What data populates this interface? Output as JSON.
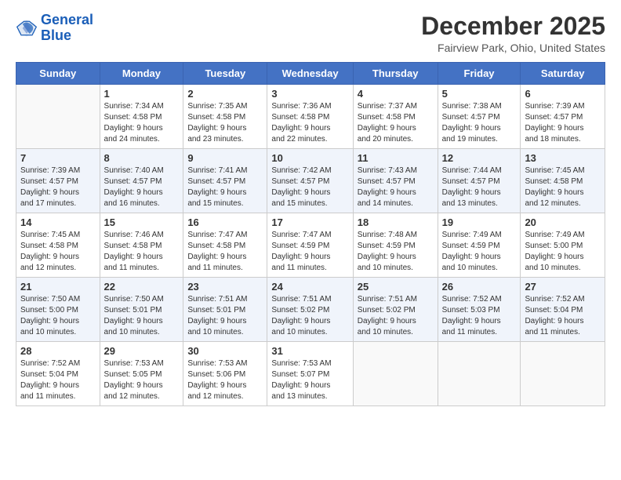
{
  "logo": {
    "line1": "General",
    "line2": "Blue"
  },
  "title": "December 2025",
  "subtitle": "Fairview Park, Ohio, United States",
  "days_header": [
    "Sunday",
    "Monday",
    "Tuesday",
    "Wednesday",
    "Thursday",
    "Friday",
    "Saturday"
  ],
  "weeks": [
    [
      {
        "num": "",
        "info": ""
      },
      {
        "num": "1",
        "info": "Sunrise: 7:34 AM\nSunset: 4:58 PM\nDaylight: 9 hours\nand 24 minutes."
      },
      {
        "num": "2",
        "info": "Sunrise: 7:35 AM\nSunset: 4:58 PM\nDaylight: 9 hours\nand 23 minutes."
      },
      {
        "num": "3",
        "info": "Sunrise: 7:36 AM\nSunset: 4:58 PM\nDaylight: 9 hours\nand 22 minutes."
      },
      {
        "num": "4",
        "info": "Sunrise: 7:37 AM\nSunset: 4:58 PM\nDaylight: 9 hours\nand 20 minutes."
      },
      {
        "num": "5",
        "info": "Sunrise: 7:38 AM\nSunset: 4:57 PM\nDaylight: 9 hours\nand 19 minutes."
      },
      {
        "num": "6",
        "info": "Sunrise: 7:39 AM\nSunset: 4:57 PM\nDaylight: 9 hours\nand 18 minutes."
      }
    ],
    [
      {
        "num": "7",
        "info": "Sunrise: 7:39 AM\nSunset: 4:57 PM\nDaylight: 9 hours\nand 17 minutes."
      },
      {
        "num": "8",
        "info": "Sunrise: 7:40 AM\nSunset: 4:57 PM\nDaylight: 9 hours\nand 16 minutes."
      },
      {
        "num": "9",
        "info": "Sunrise: 7:41 AM\nSunset: 4:57 PM\nDaylight: 9 hours\nand 15 minutes."
      },
      {
        "num": "10",
        "info": "Sunrise: 7:42 AM\nSunset: 4:57 PM\nDaylight: 9 hours\nand 15 minutes."
      },
      {
        "num": "11",
        "info": "Sunrise: 7:43 AM\nSunset: 4:57 PM\nDaylight: 9 hours\nand 14 minutes."
      },
      {
        "num": "12",
        "info": "Sunrise: 7:44 AM\nSunset: 4:57 PM\nDaylight: 9 hours\nand 13 minutes."
      },
      {
        "num": "13",
        "info": "Sunrise: 7:45 AM\nSunset: 4:58 PM\nDaylight: 9 hours\nand 12 minutes."
      }
    ],
    [
      {
        "num": "14",
        "info": "Sunrise: 7:45 AM\nSunset: 4:58 PM\nDaylight: 9 hours\nand 12 minutes."
      },
      {
        "num": "15",
        "info": "Sunrise: 7:46 AM\nSunset: 4:58 PM\nDaylight: 9 hours\nand 11 minutes."
      },
      {
        "num": "16",
        "info": "Sunrise: 7:47 AM\nSunset: 4:58 PM\nDaylight: 9 hours\nand 11 minutes."
      },
      {
        "num": "17",
        "info": "Sunrise: 7:47 AM\nSunset: 4:59 PM\nDaylight: 9 hours\nand 11 minutes."
      },
      {
        "num": "18",
        "info": "Sunrise: 7:48 AM\nSunset: 4:59 PM\nDaylight: 9 hours\nand 10 minutes."
      },
      {
        "num": "19",
        "info": "Sunrise: 7:49 AM\nSunset: 4:59 PM\nDaylight: 9 hours\nand 10 minutes."
      },
      {
        "num": "20",
        "info": "Sunrise: 7:49 AM\nSunset: 5:00 PM\nDaylight: 9 hours\nand 10 minutes."
      }
    ],
    [
      {
        "num": "21",
        "info": "Sunrise: 7:50 AM\nSunset: 5:00 PM\nDaylight: 9 hours\nand 10 minutes."
      },
      {
        "num": "22",
        "info": "Sunrise: 7:50 AM\nSunset: 5:01 PM\nDaylight: 9 hours\nand 10 minutes."
      },
      {
        "num": "23",
        "info": "Sunrise: 7:51 AM\nSunset: 5:01 PM\nDaylight: 9 hours\nand 10 minutes."
      },
      {
        "num": "24",
        "info": "Sunrise: 7:51 AM\nSunset: 5:02 PM\nDaylight: 9 hours\nand 10 minutes."
      },
      {
        "num": "25",
        "info": "Sunrise: 7:51 AM\nSunset: 5:02 PM\nDaylight: 9 hours\nand 10 minutes."
      },
      {
        "num": "26",
        "info": "Sunrise: 7:52 AM\nSunset: 5:03 PM\nDaylight: 9 hours\nand 11 minutes."
      },
      {
        "num": "27",
        "info": "Sunrise: 7:52 AM\nSunset: 5:04 PM\nDaylight: 9 hours\nand 11 minutes."
      }
    ],
    [
      {
        "num": "28",
        "info": "Sunrise: 7:52 AM\nSunset: 5:04 PM\nDaylight: 9 hours\nand 11 minutes."
      },
      {
        "num": "29",
        "info": "Sunrise: 7:53 AM\nSunset: 5:05 PM\nDaylight: 9 hours\nand 12 minutes."
      },
      {
        "num": "30",
        "info": "Sunrise: 7:53 AM\nSunset: 5:06 PM\nDaylight: 9 hours\nand 12 minutes."
      },
      {
        "num": "31",
        "info": "Sunrise: 7:53 AM\nSunset: 5:07 PM\nDaylight: 9 hours\nand 13 minutes."
      },
      {
        "num": "",
        "info": ""
      },
      {
        "num": "",
        "info": ""
      },
      {
        "num": "",
        "info": ""
      }
    ]
  ]
}
